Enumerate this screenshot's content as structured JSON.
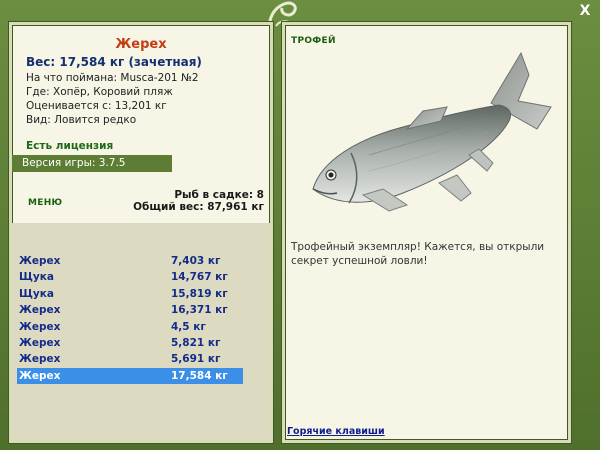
{
  "window": {
    "close_label": "X"
  },
  "fish_info": {
    "name": "Жерех",
    "weight_line": "Вес: 17,584 кг (зачетная)",
    "bait_line": "На что поймана: Musca-201 №2",
    "location_line": "Где: Хопёр, Коровий пляж",
    "value_line": "Оценивается с: 13,201 кг",
    "type_line": "Вид: Ловится редко"
  },
  "license_text": "Есть лицензия",
  "version_text": "Версия игры: 3.7.5",
  "menu_label": "МЕНЮ",
  "summary": {
    "fish_count": "Рыб в садке: 8",
    "total_weight": "Общий вес: 87,961 кг"
  },
  "catch_list": [
    {
      "name": "Жерех",
      "weight": "7,403 кг"
    },
    {
      "name": "Щука",
      "weight": "14,767 кг"
    },
    {
      "name": "Щука",
      "weight": "15,819 кг"
    },
    {
      "name": "Жерех",
      "weight": "16,371 кг"
    },
    {
      "name": "Жерех",
      "weight": "4,5 кг"
    },
    {
      "name": "Жерех",
      "weight": "5,821 кг"
    },
    {
      "name": "Жерех",
      "weight": "5,691 кг"
    },
    {
      "name": "Жерех",
      "weight": "17,584 кг",
      "selected": true
    }
  ],
  "trophy": {
    "label": "ТРОФЕЙ",
    "description": "Трофейный экземпляр! Кажется, вы открыли секрет успешной ловли!"
  },
  "hotkeys_link": "Горячие клавиши",
  "colors": {
    "frame_green": "#5a7a36",
    "panel_bg": "#f6f5e6",
    "list_bg": "#dcdac0",
    "selected_row": "#3b8fe6",
    "fish_name": "#c43d12",
    "list_text": "#142c88",
    "license_green": "#1f6a17"
  }
}
